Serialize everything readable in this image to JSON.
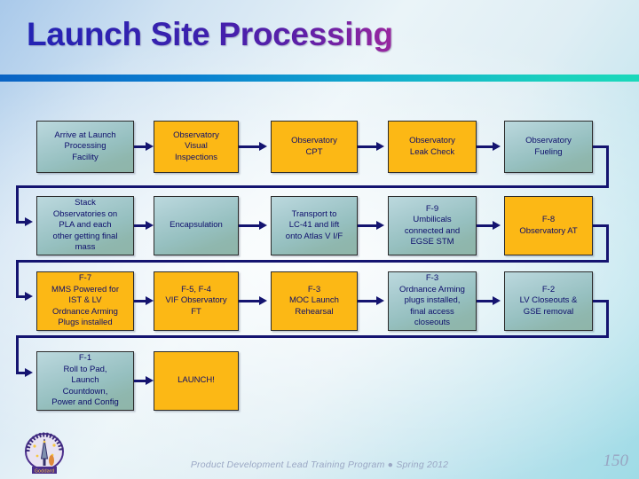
{
  "slide": {
    "title": "Launch Site Processing",
    "page_number": "150",
    "footer": "Product Development Lead Training Program   ●   Spring 2012",
    "colors": {
      "title_start": "#2323b4",
      "title_end": "#99279f",
      "rule_start": "#0a63c4",
      "rule_end": "#1ad8bb",
      "box_gold": "#fcb815",
      "box_teal": "#a9ccd0",
      "connector": "#141470",
      "box_text": "#0d0d6b"
    },
    "logo_alt": "mission-logo"
  },
  "flow": {
    "rows": [
      {
        "boxes": [
          {
            "label": "Arrive at Launch\nProcessing\nFacility",
            "style": "teal"
          },
          {
            "label": "Observatory\nVisual\nInspections",
            "style": "gold"
          },
          {
            "label": "Observatory\nCPT",
            "style": "gold"
          },
          {
            "label": "Observatory\nLeak Check",
            "style": "gold"
          },
          {
            "label": "Observatory\nFueling",
            "style": "teal"
          }
        ]
      },
      {
        "boxes": [
          {
            "label": "Stack\nObservatories on\nPLA and each\nother getting final\nmass",
            "style": "teal"
          },
          {
            "label": "Encapsulation",
            "style": "teal"
          },
          {
            "label": "Transport to\nLC-41 and lift\nonto Atlas V I/F",
            "style": "teal"
          },
          {
            "label": "F-9\nUmbilicals\nconnected and\nEGSE STM",
            "style": "teal"
          },
          {
            "label": "F-8\nObservatory AT",
            "style": "gold"
          }
        ]
      },
      {
        "boxes": [
          {
            "label": "F-7\nMMS Powered for\nIST & LV\nOrdnance Arming\nPlugs installed",
            "style": "gold"
          },
          {
            "label": "F-5, F-4\nVIF Observatory\nFT",
            "style": "gold"
          },
          {
            "label": "F-3\nMOC Launch\nRehearsal",
            "style": "gold"
          },
          {
            "label": "F-3\nOrdnance Arming\nplugs installed,\nfinal access\ncloseouts",
            "style": "teal"
          },
          {
            "label": "F-2\nLV Closeouts &\nGSE removal",
            "style": "teal"
          }
        ]
      },
      {
        "boxes": [
          {
            "label": "F-1\nRoll to Pad,\nLaunch\nCountdown,\nPower and Config",
            "style": "teal"
          },
          {
            "label": "LAUNCH!",
            "style": "gold"
          }
        ]
      }
    ]
  }
}
